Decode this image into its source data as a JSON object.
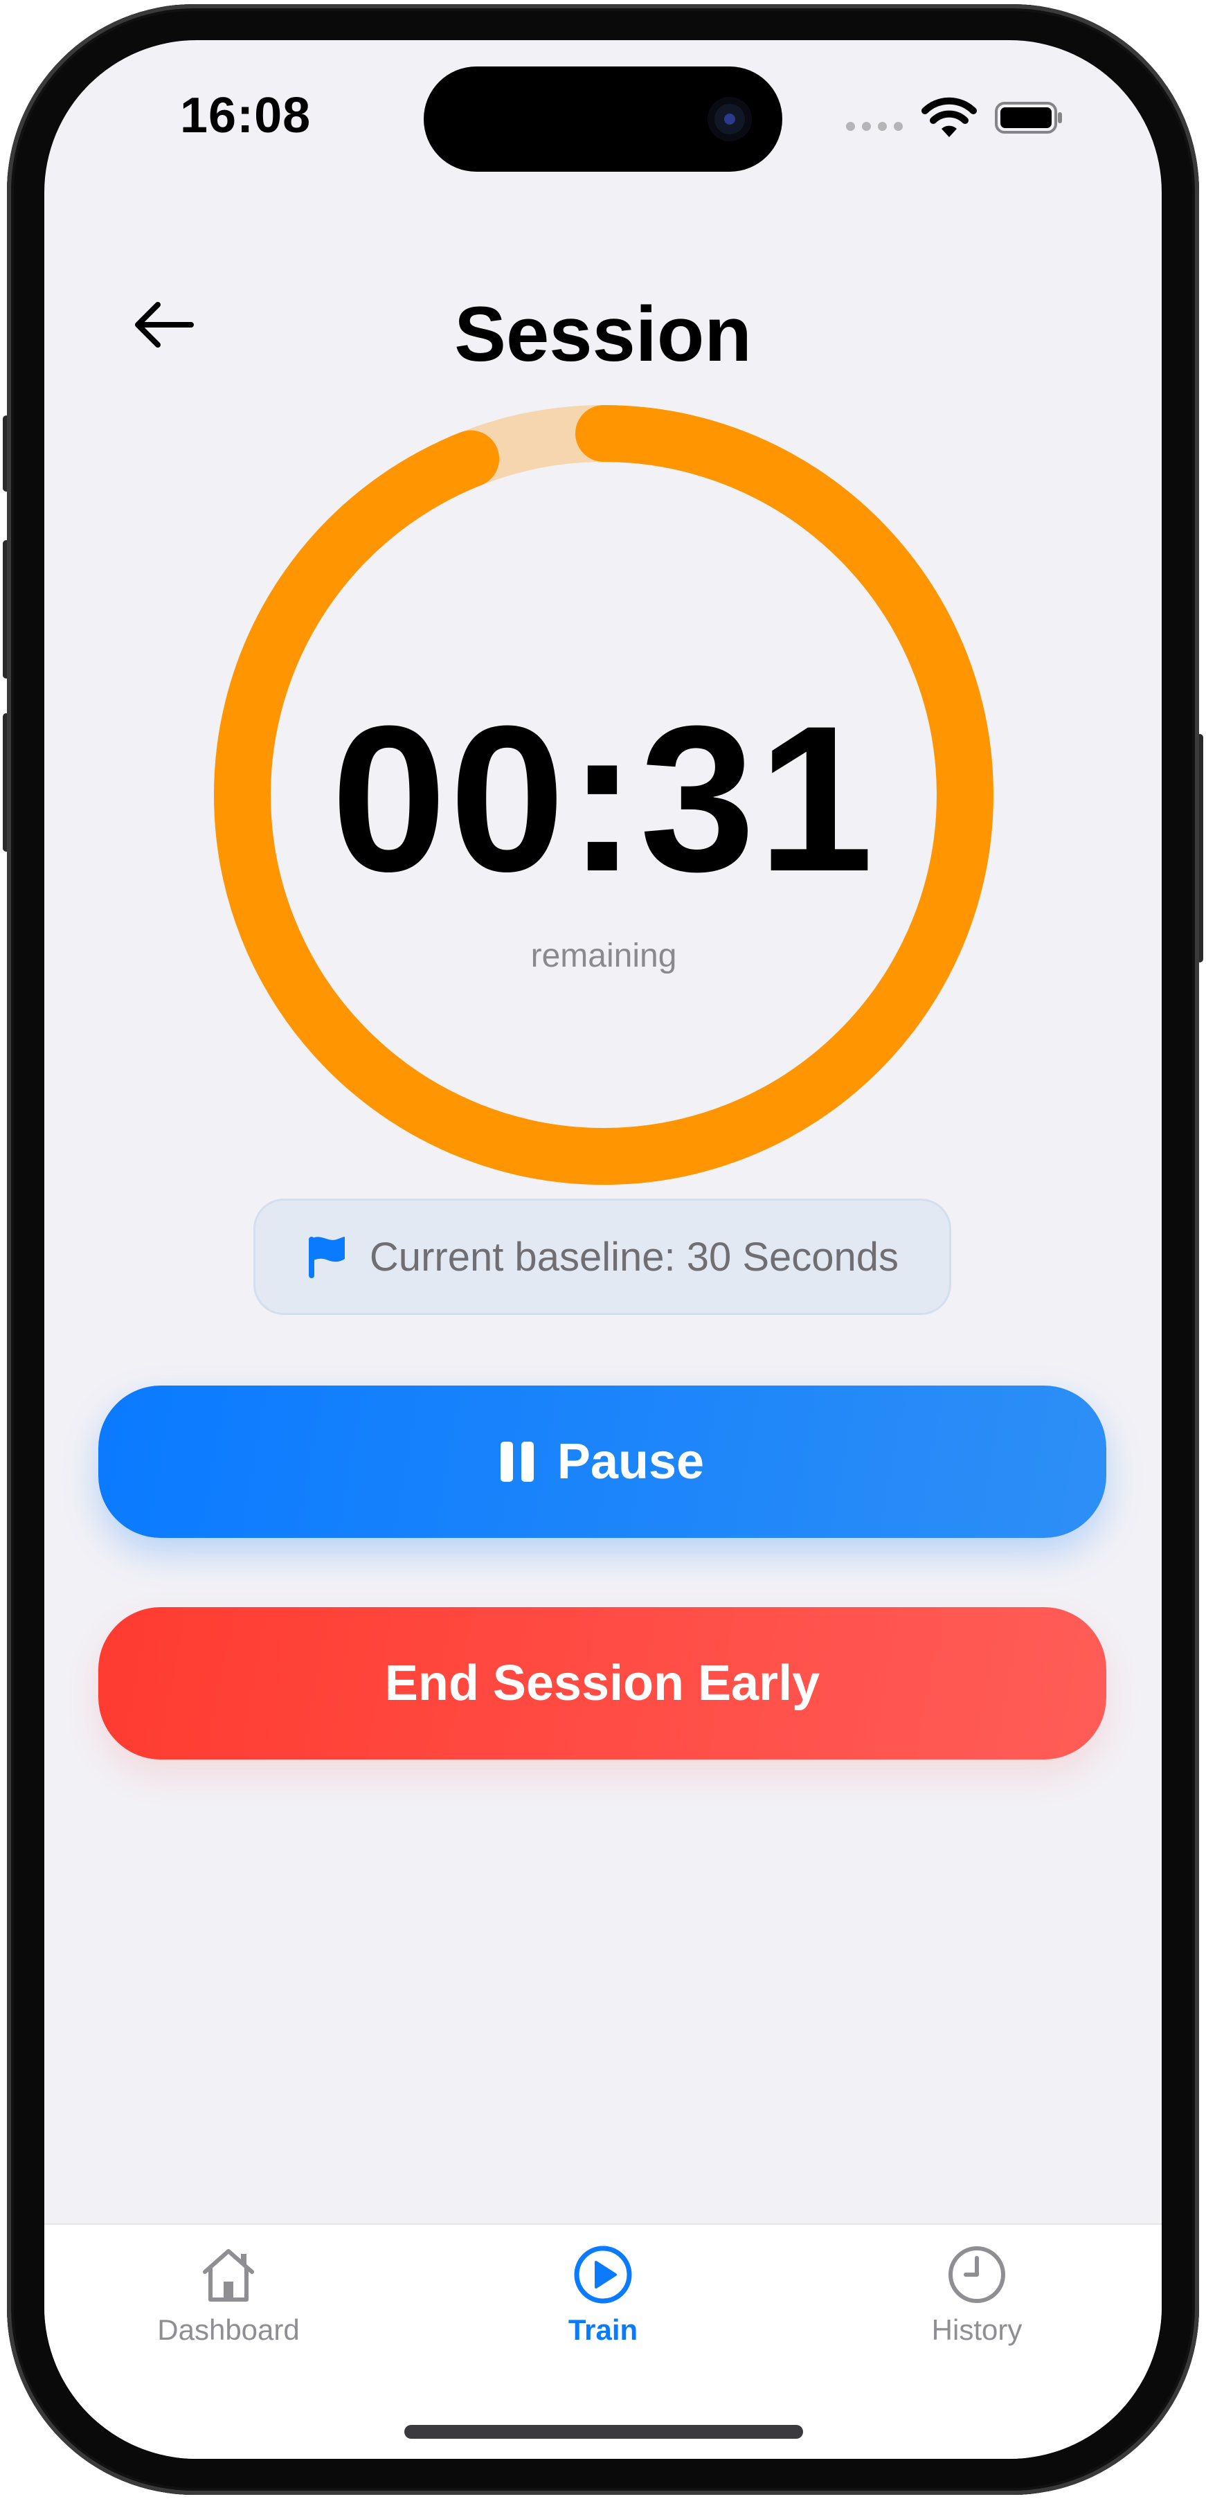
{
  "status_bar": {
    "time": "16:08"
  },
  "header": {
    "title": "Session"
  },
  "timer": {
    "display": "00:31",
    "caption": "remaining",
    "progress_fraction": 0.94,
    "ring_color": "#ff9500",
    "track_color": "#f6d6ae"
  },
  "baseline": {
    "label": "Current baseline: 30 Seconds",
    "icon": "flag-icon",
    "icon_color": "#0a7aff"
  },
  "actions": {
    "pause_label": "Pause",
    "pause_icon": "pause-icon",
    "end_label": "End Session Early"
  },
  "tabbar": {
    "items": [
      {
        "label": "Dashboard",
        "icon": "house-icon",
        "active": false
      },
      {
        "label": "Train",
        "icon": "play-circle-icon",
        "active": true
      },
      {
        "label": "History",
        "icon": "clock-icon",
        "active": false
      }
    ]
  },
  "colors": {
    "accent_blue": "#0a7aff",
    "danger_red": "#ff3b30",
    "timer_orange": "#ff9500",
    "background": "#f2f1f6"
  }
}
